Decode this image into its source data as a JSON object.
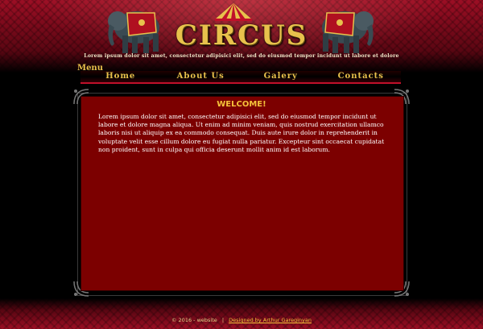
{
  "header": {
    "logo": "CIRCUS",
    "tagline": "Lorem ipsum dolor sit amet, consectetur adipisici elit, sed do eiusmod tempor incidunt ut labore et dolore"
  },
  "menu": {
    "title": "Menu",
    "items": [
      {
        "label": "Home"
      },
      {
        "label": "About Us"
      },
      {
        "label": "Galery"
      },
      {
        "label": "Contacts"
      }
    ]
  },
  "content": {
    "heading": "WELCOME!",
    "paragraph": "Lorem ipsum dolor sit amet, consectetur adipisici elit, sed do eiusmod tempor incidunt ut labore et dolore magna aliqua. Ut enim ad minim veniam, quis nostrud exercitation ullamco laboris nisi ut aliquip ex ea commodo consequat. Duis aute irure dolor in reprehenderit in voluptate velit esse cillum dolore eu fugiat nulla pariatur. Excepteur sint occaecat cupidatat non proident, sunt in culpa qui officia deserunt mollit anim id est laborum."
  },
  "footer": {
    "copyright": "© 2016 - website",
    "separator": "|",
    "designer_link": "Designed by Arthur Gareginyan"
  },
  "colors": {
    "accent_gold": "#e8c14c",
    "panel_red": "#7c0000",
    "band_red": "#9c0e24"
  }
}
